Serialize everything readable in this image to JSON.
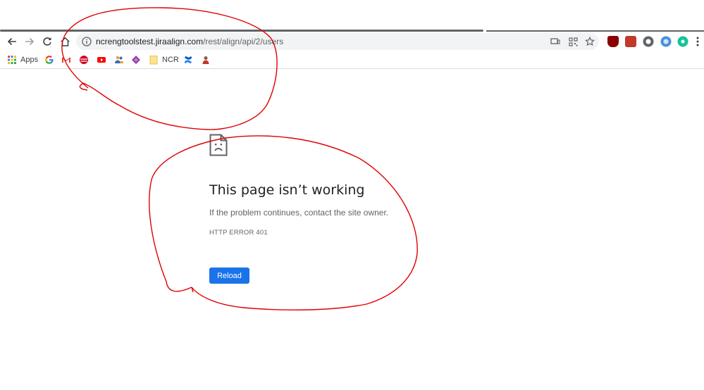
{
  "toolbar": {
    "back_icon": "back-arrow-icon",
    "forward_icon": "forward-arrow-icon",
    "reload_icon": "reload-icon",
    "home_icon": "home-icon"
  },
  "omnibox": {
    "host": "ncrengtoolstest.jiraalign.com",
    "path": "/rest/align/api/2/users",
    "info_icon": "info-icon",
    "cast_icon": "cast-icon",
    "qr_icon": "qr-code-icon",
    "star_icon": "bookmark-star-icon"
  },
  "extensions": [
    {
      "name": "ublock-icon",
      "color": "#800000"
    },
    {
      "name": "red-square-extension-icon",
      "color": "#c0392b"
    },
    {
      "name": "circle-extension-icon",
      "color": "#5f6368"
    },
    {
      "name": "blue-extension-icon",
      "color": "#4a90d9"
    },
    {
      "name": "grammarly-icon",
      "color": "#15c39a"
    }
  ],
  "bookmarks": {
    "apps_label": "Apps",
    "ncr_label": "NCR"
  },
  "error": {
    "title": "This page isn’t working",
    "message": "If the problem continues, contact the site owner.",
    "code": "HTTP ERROR 401",
    "reload_label": "Reload"
  },
  "colors": {
    "accent": "#1a73e8",
    "annotation": "#e00000"
  }
}
